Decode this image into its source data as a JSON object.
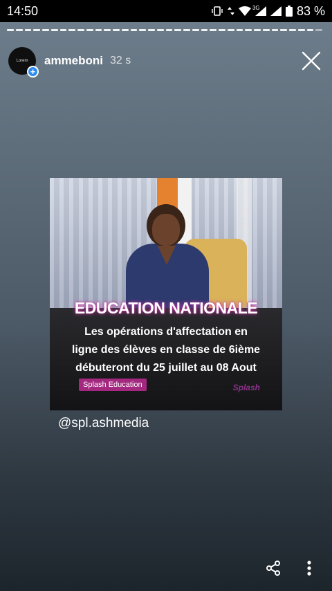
{
  "status_bar": {
    "time": "14:50",
    "network": "3G",
    "battery": "83 %",
    "icons": [
      "vibrate-icon",
      "data-arrows-icon",
      "wifi-icon",
      "signal-icon",
      "signal-icon",
      "battery-icon"
    ]
  },
  "story": {
    "progress_segments_total": 36,
    "progress_segments_viewed": 35,
    "username": "ammeboni",
    "time_ago": "32 s",
    "avatar_text": "Lorem",
    "image": {
      "headline": "EDUCATION NATIONALE",
      "line1": "Les opérations d'affectation en",
      "line2": "ligne des élèves en classe de 6ième",
      "line3": "débuteront du 25 juillet au 08 Aout",
      "badge": "Splash Education",
      "watermark": "Splash"
    },
    "mention": "@spl.ashmedia"
  },
  "actions": {
    "share_icon": "share-icon",
    "more_icon": "more-vertical-icon",
    "close_icon": "close-icon"
  },
  "colors": {
    "headline_glow": "#d23aa9",
    "badge_bg": "#a4287f",
    "avatar_plus": "#2a8cf0"
  }
}
